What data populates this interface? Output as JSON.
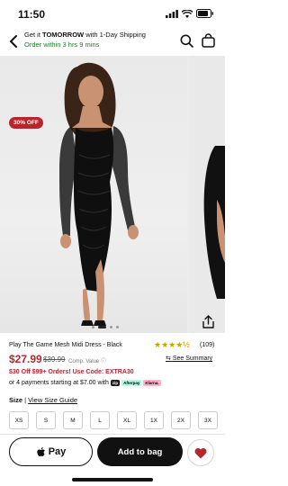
{
  "status_bar": {
    "time": "11:50"
  },
  "shipping": {
    "prefix": "Get it ",
    "highlight": "TOMORROW",
    "suffix": " with 1-Day Shipping",
    "order_within": "Order within 3 hrs 9 mins"
  },
  "gallery": {
    "badge": "30% OFF",
    "image_count": 4,
    "active_index": 0
  },
  "product": {
    "title": "Play The Game Mesh Midi Dress - Black",
    "rating": 4.5,
    "stars": "★★★★½",
    "review_count": "(109)",
    "price": "$27.99",
    "old_price": "$39.99",
    "comp_label": "Comp. Value ⓘ",
    "see_summary": "See Summary",
    "promo": "$30 Off $99+ Orders! Use Code: EXTRA30",
    "payments_text": "or 4 payments starting at $7.00 with",
    "payment_chips": [
      "zip",
      "Afterpay",
      "Klarna."
    ]
  },
  "size": {
    "label": "Size",
    "guide": "View Size Guide",
    "options": [
      "XS",
      "S",
      "M",
      "L",
      "XL",
      "1X",
      "2X",
      "3X"
    ]
  },
  "actions": {
    "apple_pay": "Pay",
    "add_to_bag": "Add to bag"
  },
  "colors": {
    "accent": "#b3282d",
    "success": "#1f7a2e",
    "primary": "#111111"
  }
}
